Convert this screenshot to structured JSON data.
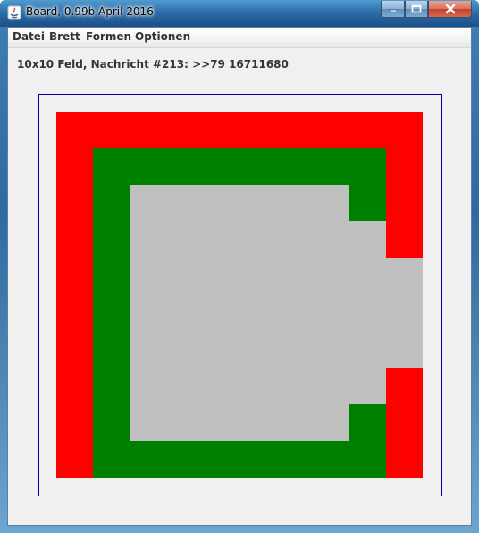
{
  "window": {
    "title": "Board, 0.99b April 2016"
  },
  "menu": {
    "items": [
      "Datei",
      "Brett",
      "Formen",
      "Optionen"
    ]
  },
  "status": {
    "text": "10x10 Feld, Nachricht #213: >>79 16711680"
  },
  "board": {
    "size": 10,
    "colors": {
      "r": "#ff0000",
      "g": "#008000",
      "s": "#c0c0c0"
    },
    "rows": [
      "rrrrrrrrrr",
      "rggggggggr",
      "rgssssssgr",
      "rgsssssssr",
      "rgssssssss",
      "rgssssssss",
      "rgssssssss",
      "rgsssssssr",
      "rgssssssgr",
      "rggggggggr"
    ],
    "bottom_row": "rrrrrrrrrr"
  }
}
